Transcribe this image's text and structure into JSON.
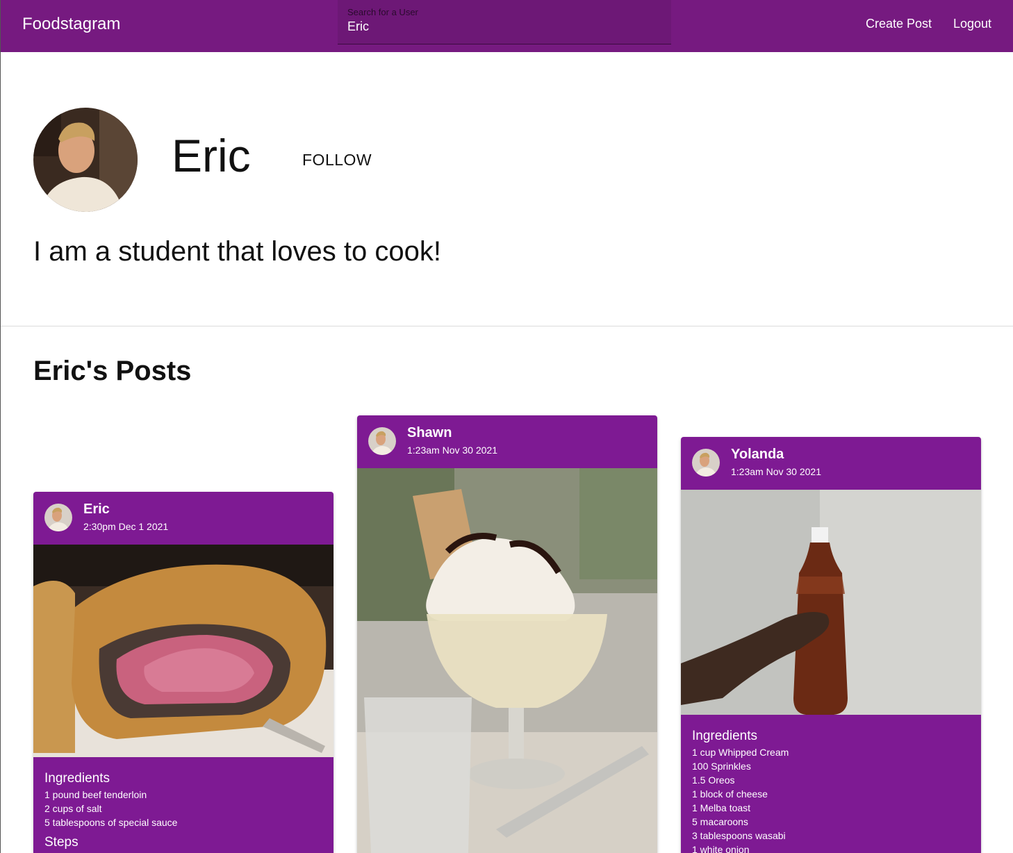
{
  "app": {
    "brand": "Foodstagram",
    "search": {
      "label": "Search for a User",
      "value": "Eric"
    },
    "nav": {
      "create_post": "Create Post",
      "logout": "Logout"
    }
  },
  "profile": {
    "name": "Eric",
    "follow_label": "FOLLOW",
    "bio": "I am a student that loves to cook!"
  },
  "posts_heading": "Eric's Posts",
  "posts": [
    {
      "author": "Eric",
      "time": "2:30pm Dec 1 2021",
      "ingredients_title": "Ingredients",
      "ingredients": [
        "1 pound beef tenderloin",
        "2 cups of salt",
        "5 tablespoons of special sauce"
      ],
      "steps_title": "Steps"
    },
    {
      "author": "Shawn",
      "time": "1:23am Nov 30 2021"
    },
    {
      "author": "Yolanda",
      "time": "1:23am Nov 30 2021",
      "ingredients_title": "Ingredients",
      "ingredients": [
        "1 cup Whipped Cream",
        "100 Sprinkles",
        "1.5 Oreos",
        "1 block of cheese",
        "1 Melba toast",
        "5 macaroons",
        "3 tablespoons wasabi",
        "1 white onion"
      ]
    }
  ],
  "colors": {
    "appbar": "#761a80",
    "card": "#7e1a93",
    "text": "#111111"
  }
}
